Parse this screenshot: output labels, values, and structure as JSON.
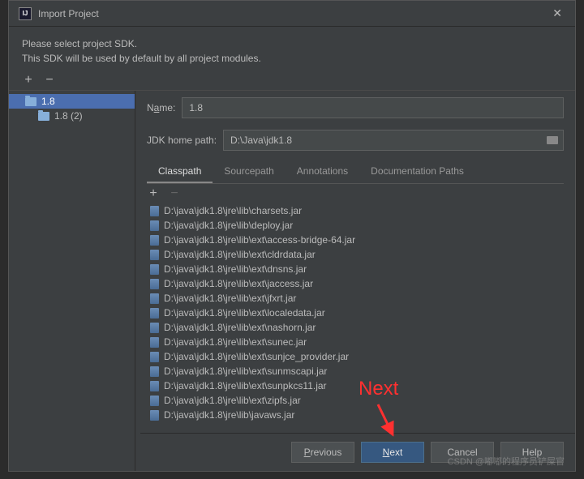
{
  "titlebar": {
    "title": "Import Project"
  },
  "instruction": {
    "line1": "Please select project SDK.",
    "line2": "This SDK will be used by default by all project modules."
  },
  "sidebar": {
    "items": [
      {
        "label": "1.8",
        "selected": true
      },
      {
        "label": "1.8 (2)",
        "selected": false
      }
    ]
  },
  "fields": {
    "name": {
      "label_pre": "N",
      "label_u": "a",
      "label_post": "me:",
      "value": "1.8"
    },
    "homepath": {
      "label": "JDK home path:",
      "value": "D:\\Java\\jdk1.8"
    }
  },
  "tabs": [
    {
      "label": "Classpath",
      "active": true
    },
    {
      "label": "Sourcepath",
      "active": false
    },
    {
      "label": "Annotations",
      "active": false
    },
    {
      "label": "Documentation Paths",
      "active": false
    }
  ],
  "classpath_items": [
    "D:\\java\\jdk1.8\\jre\\lib\\charsets.jar",
    "D:\\java\\jdk1.8\\jre\\lib\\deploy.jar",
    "D:\\java\\jdk1.8\\jre\\lib\\ext\\access-bridge-64.jar",
    "D:\\java\\jdk1.8\\jre\\lib\\ext\\cldrdata.jar",
    "D:\\java\\jdk1.8\\jre\\lib\\ext\\dnsns.jar",
    "D:\\java\\jdk1.8\\jre\\lib\\ext\\jaccess.jar",
    "D:\\java\\jdk1.8\\jre\\lib\\ext\\jfxrt.jar",
    "D:\\java\\jdk1.8\\jre\\lib\\ext\\localedata.jar",
    "D:\\java\\jdk1.8\\jre\\lib\\ext\\nashorn.jar",
    "D:\\java\\jdk1.8\\jre\\lib\\ext\\sunec.jar",
    "D:\\java\\jdk1.8\\jre\\lib\\ext\\sunjce_provider.jar",
    "D:\\java\\jdk1.8\\jre\\lib\\ext\\sunmscapi.jar",
    "D:\\java\\jdk1.8\\jre\\lib\\ext\\sunpkcs11.jar",
    "D:\\java\\jdk1.8\\jre\\lib\\ext\\zipfs.jar",
    "D:\\java\\jdk1.8\\jre\\lib\\javaws.jar"
  ],
  "buttons": {
    "previous": {
      "pre": "",
      "u": "P",
      "post": "revious"
    },
    "next": {
      "pre": "",
      "u": "N",
      "post": "ext"
    },
    "cancel": "Cancel",
    "help": "Help"
  },
  "annotation": {
    "text": "Next"
  },
  "watermark": "CSDN @嘟嘟的程序员铲屎官"
}
